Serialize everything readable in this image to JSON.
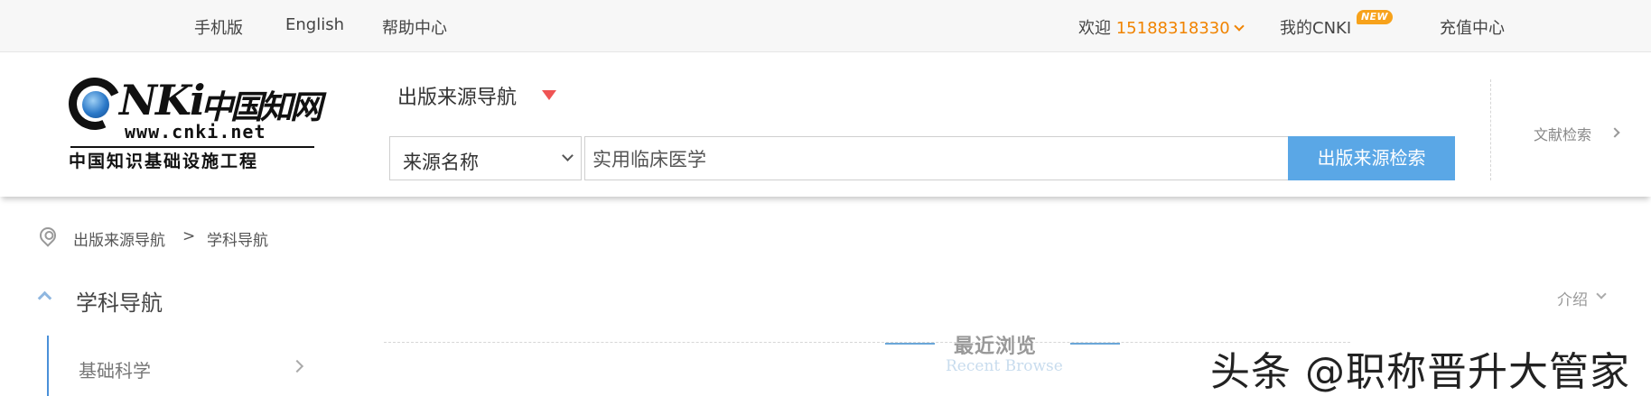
{
  "topbar": {
    "mobile": "手机版",
    "english": "English",
    "help": "帮助中心",
    "welcome": "欢迎",
    "user": "15188318330",
    "my_cnki": "我的CNKI",
    "new_badge": "NEW",
    "recharge": "充值中心"
  },
  "logo": {
    "cn": "中国知网",
    "url": "www.cnki.net",
    "subtitle": "中国知识基础设施工程",
    "letters": "NKi"
  },
  "header": {
    "nav_title": "出版来源导航",
    "select_value": "来源名称",
    "search_value": "实用临床医学",
    "search_button": "出版来源检索",
    "literature_search": "文献检索"
  },
  "breadcrumb": {
    "items": [
      "出版来源导航",
      "学科导航"
    ],
    "separator": ">"
  },
  "subject_nav": {
    "title": "学科导航",
    "intro": "介绍",
    "items": [
      "基础科学"
    ]
  },
  "recent": {
    "title_cn": "最近浏览",
    "title_en": "Recent Browse"
  },
  "watermark": "头条 @职称晋升大管家",
  "colors": {
    "accent_orange": "#f08300",
    "button_blue": "#5aa7e6",
    "triangle_red": "#ef5454"
  }
}
